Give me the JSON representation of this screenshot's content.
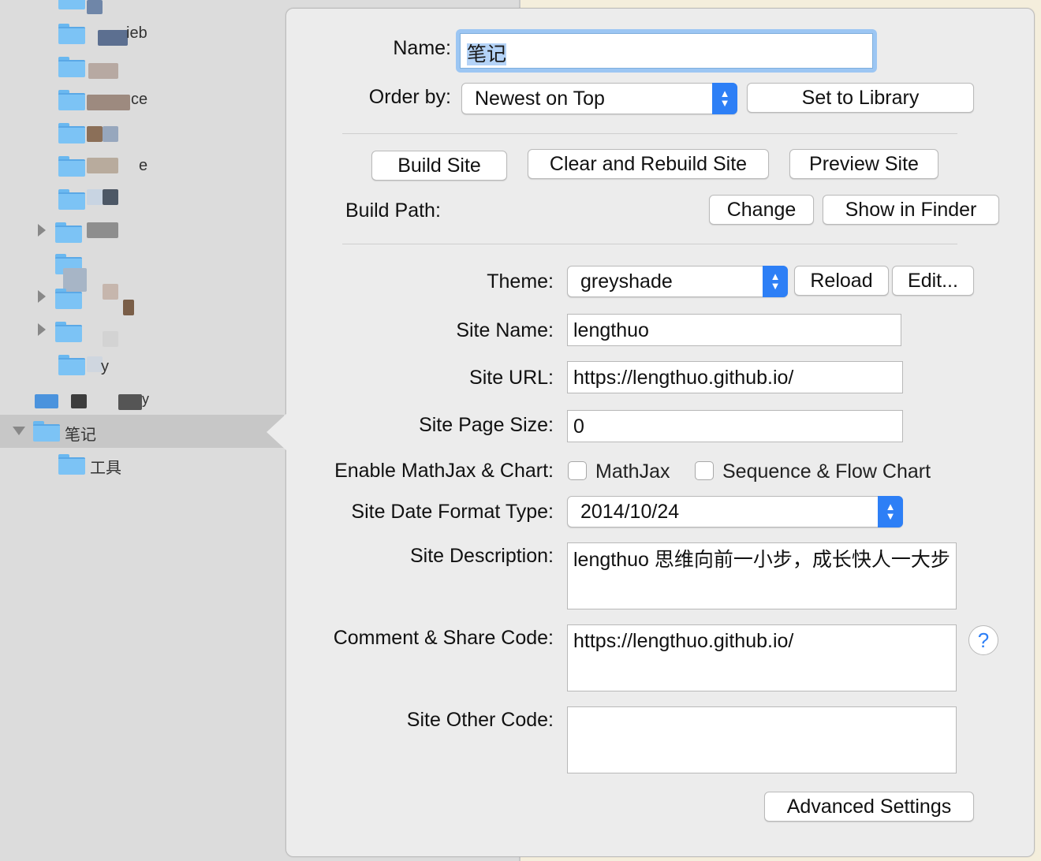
{
  "sidebar": {
    "items": [
      {
        "label": "ieb"
      },
      {
        "label": "ce"
      },
      {
        "label": "e"
      },
      {
        "label": "y"
      },
      {
        "label": "y"
      },
      {
        "label": "笔记"
      },
      {
        "label": "工具"
      }
    ]
  },
  "form": {
    "name_label": "Name:",
    "name_value": "笔记",
    "order_label": "Order by:",
    "order_value": "Newest on Top",
    "set_library_button": "Set to Library",
    "build_site_button": "Build Site",
    "clear_rebuild_button": "Clear and Rebuild Site",
    "preview_button": "Preview Site",
    "build_path_label": "Build Path:",
    "change_button": "Change",
    "show_finder_button": "Show in Finder",
    "theme_label": "Theme:",
    "theme_value": "greyshade",
    "reload_button": "Reload",
    "edit_button": "Edit...",
    "site_name_label": "Site Name:",
    "site_name_value": "lengthuo",
    "site_url_label": "Site URL:",
    "site_url_value": "https://lengthuo.github.io/",
    "page_size_label": "Site Page Size:",
    "page_size_value": "0",
    "mathjax_label": "Enable MathJax & Chart:",
    "mathjax_check": "MathJax",
    "flowchart_check": "Sequence & Flow Chart",
    "date_format_label": "Site Date Format Type:",
    "date_format_value": "2014/10/24",
    "description_label": "Site Description:",
    "description_value": "lengthuo 思维向前一小步，成长快人一大步",
    "comment_label": "Comment & Share Code:",
    "comment_value": "https://lengthuo.github.io/",
    "help_icon": "?",
    "other_code_label": "Site Other Code:",
    "other_code_value": "",
    "advanced_button": "Advanced Settings"
  },
  "colors": {
    "accent": "#2d7ff6",
    "popover_bg": "#ececec",
    "sidebar_bg": "#dcdcdc",
    "selected_row": "#c7c7c7"
  }
}
